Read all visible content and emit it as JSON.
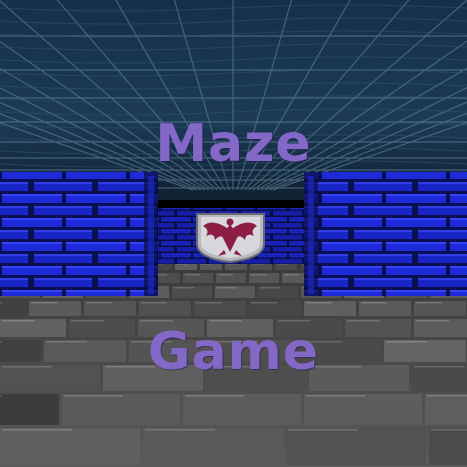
{
  "title": {
    "line1": "Maze",
    "line2": "Game"
  },
  "emblem": {
    "icon": "eagle-crest-icon"
  },
  "colors": {
    "title_text": "#8468c8",
    "ceiling": "#1c3a56",
    "ceiling_grid": "#6a8ca6",
    "wall_brick": "#1d2ad8",
    "wall_mortar": "#0b0f52",
    "floor_stone": "#5e5e5e",
    "floor_mortar": "#1e1e1e",
    "emblem_red": "#8c1e46"
  }
}
